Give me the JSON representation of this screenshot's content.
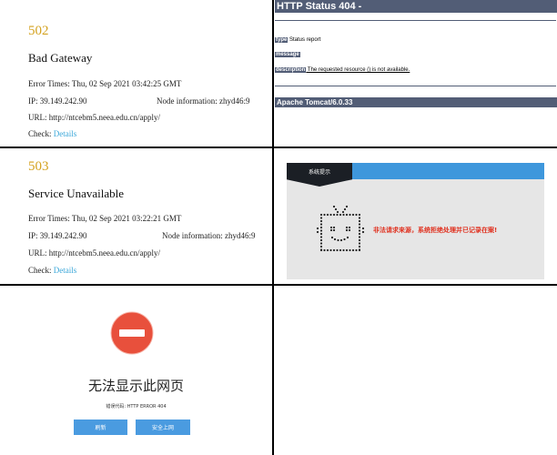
{
  "panel_502": {
    "code": "502",
    "title": "Bad Gateway",
    "error_times": "Error Times: Thu, 02 Sep 2021 03:42:25 GMT",
    "ip": "IP: 39.149.242.90",
    "node": "Node information: zhyd46:9",
    "url": "URL: http://ntcebm5.neea.edu.cn/apply/",
    "check_label": "Check: ",
    "check_link": "Details"
  },
  "panel_404": {
    "title": "HTTP Status 404 -",
    "type_key": "type",
    "type_val": " Status report",
    "message_key": "message",
    "message_val": "",
    "description_key": "description",
    "description_val": " The requested resource () is not available.",
    "footer": "Apache Tomcat/6.0.33"
  },
  "panel_503": {
    "code": "503",
    "title": "Service Unavailable",
    "error_times": "Error Times: Thu, 02 Sep 2021 03:22:21 GMT",
    "ip": "IP: 39.149.242.90",
    "node": "Node information: zhyd46:9",
    "url": "URL: http://ntcebm5.neea.edu.cn/apply/",
    "check_label": "Check: ",
    "check_link": "Details"
  },
  "panel_system": {
    "tab_label": "系统提示",
    "message": "非法请求来源，系统拒绝处理并已记录在案!",
    "icon": "dotted-tv-icon"
  },
  "panel_browser": {
    "title": "无法显示此网页",
    "error_code": "错误代码:  HTTP ERROR 404",
    "refresh_label": "刷新",
    "safe_label": "安全上网",
    "icon": "stop-icon"
  },
  "colors": {
    "code_gold": "#d4a21f",
    "link_blue": "#3aa7d9",
    "tomcat_bar": "#525d76",
    "sys_blue": "#3e97dc",
    "sys_red": "#e0301e",
    "stop_red": "#e8503c",
    "button_blue": "#4a9be0"
  }
}
